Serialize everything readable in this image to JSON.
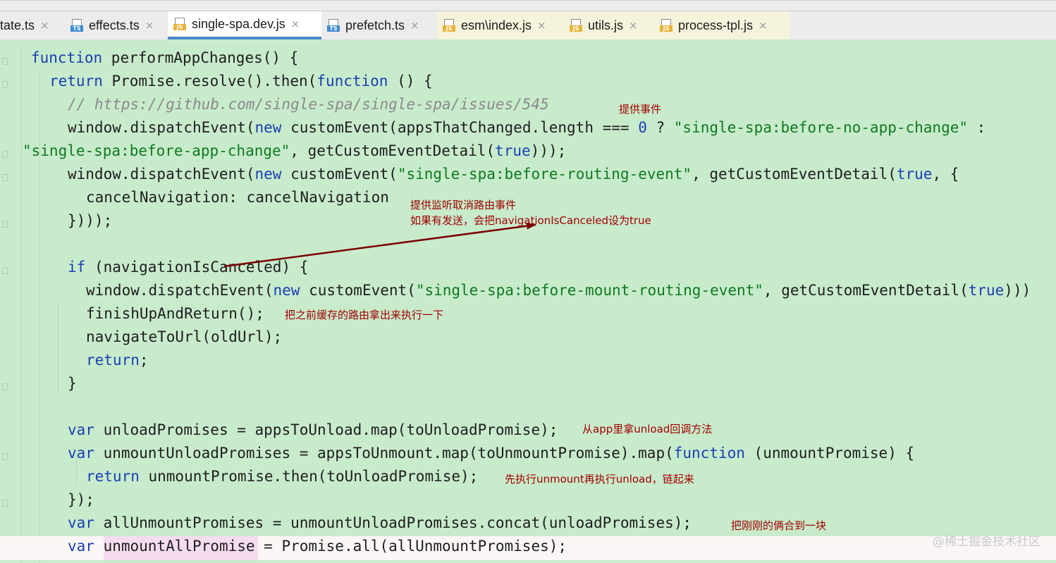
{
  "tabs": [
    {
      "label": "tate.ts",
      "type": "ts",
      "icon": "ts-file-icon"
    },
    {
      "label": "effects.ts",
      "type": "ts",
      "icon": "ts-file-icon"
    },
    {
      "label": "single-spa.dev.js",
      "type": "js",
      "icon": "js-file-icon",
      "active": true
    },
    {
      "label": "prefetch.ts",
      "type": "ts",
      "icon": "ts-file-icon"
    },
    {
      "label": "esm\\index.js",
      "type": "js",
      "icon": "js-file-icon"
    },
    {
      "label": "utils.js",
      "type": "js",
      "icon": "js-file-icon"
    },
    {
      "label": "process-tpl.js",
      "type": "js",
      "icon": "js-file-icon"
    }
  ],
  "tab_badges": {
    "ts": "TS",
    "js": "JS"
  },
  "close_glyph": "×",
  "code_lines": [
    [
      {
        "t": "function",
        "c": "kw"
      },
      {
        "t": " performAppChanges() {"
      }
    ],
    [
      {
        "t": "return",
        "c": "kw"
      },
      {
        "t": " Promise.resolve().then("
      },
      {
        "t": "function",
        "c": "kw"
      },
      {
        "t": " () {"
      }
    ],
    [
      {
        "t": "// https://github.com/single-spa/single-spa/issues/545",
        "c": "cmt"
      }
    ],
    [
      {
        "t": "window.dispatchEvent("
      },
      {
        "t": "new",
        "c": "kw"
      },
      {
        "t": " customEvent(appsThatChanged.length === "
      },
      {
        "t": "0",
        "c": "num"
      },
      {
        "t": " ? "
      },
      {
        "t": "\"single-spa:before-no-app-change\"",
        "c": "str"
      },
      {
        "t": " :"
      }
    ],
    [
      {
        "t": "\"single-spa:before-app-change\"",
        "c": "str"
      },
      {
        "t": ", getCustomEventDetail("
      },
      {
        "t": "true",
        "c": "kw"
      },
      {
        "t": ")));"
      }
    ],
    [
      {
        "t": "window.dispatchEvent("
      },
      {
        "t": "new",
        "c": "kw"
      },
      {
        "t": " customEvent("
      },
      {
        "t": "\"single-spa:before-routing-event\"",
        "c": "str"
      },
      {
        "t": ", getCustomEventDetail("
      },
      {
        "t": "true",
        "c": "kw"
      },
      {
        "t": ", {"
      }
    ],
    [
      {
        "t": "cancelNavigation: cancelNavigation"
      }
    ],
    [
      {
        "t": "})));"
      }
    ],
    [],
    [
      {
        "t": "if",
        "c": "kw"
      },
      {
        "t": " (navigationIsCanceled) {"
      }
    ],
    [
      {
        "t": "window.dispatchEvent("
      },
      {
        "t": "new",
        "c": "kw"
      },
      {
        "t": " customEvent("
      },
      {
        "t": "\"single-spa:before-mount-routing-event\"",
        "c": "str"
      },
      {
        "t": ", getCustomEventDetail("
      },
      {
        "t": "true",
        "c": "kw"
      },
      {
        "t": ")))"
      }
    ],
    [
      {
        "t": "finishUpAndReturn();"
      }
    ],
    [
      {
        "t": "navigateToUrl(oldUrl);"
      }
    ],
    [
      {
        "t": "return",
        "c": "kw"
      },
      {
        "t": ";"
      }
    ],
    [
      {
        "t": "}"
      }
    ],
    [],
    [
      {
        "t": "var",
        "c": "kw"
      },
      {
        "t": " unloadPromises = appsToUnload.map(toUnloadPromise);"
      }
    ],
    [
      {
        "t": "var",
        "c": "kw"
      },
      {
        "t": " unmountUnloadPromises = appsToUnmount.map(toUnmountPromise).map("
      },
      {
        "t": "function",
        "c": "kw"
      },
      {
        "t": " (unmountPromise) {"
      }
    ],
    [
      {
        "t": "return",
        "c": "kw"
      },
      {
        "t": " unmountPromise.then(toUnloadPromise);"
      }
    ],
    [
      {
        "t": "});"
      }
    ],
    [
      {
        "t": "var",
        "c": "kw"
      },
      {
        "t": " allUnmountPromises = unmountUnloadPromises.concat(unloadPromises);"
      }
    ],
    [
      {
        "t": "var",
        "c": "kw"
      },
      {
        "t": " unmountAllPromise = Promise.all(allUnmountPromises);"
      }
    ]
  ],
  "annotations": [
    {
      "text": "提供事件"
    },
    {
      "text": "提供监听取消路由事件"
    },
    {
      "text": "如果有发送，会把navigationIsCanceled设为true"
    },
    {
      "text": "把之前缓存的路由拿出来执行一下"
    },
    {
      "text": "从app里拿unload回调方法"
    },
    {
      "text": "先执行unmount再执行unload，链起来"
    },
    {
      "text": "把刚刚的俩合到一块"
    }
  ],
  "colors": {
    "editor_bg": "#c8ebcc",
    "keyword": "#1a3fb3",
    "string": "#0f7a1f",
    "comment": "#8a8a8a",
    "annotation": "#a10000",
    "arrow": "#7a0000",
    "active_tab_underline": "#4a88c7"
  },
  "watermark": "@稀土掘金技术社区"
}
